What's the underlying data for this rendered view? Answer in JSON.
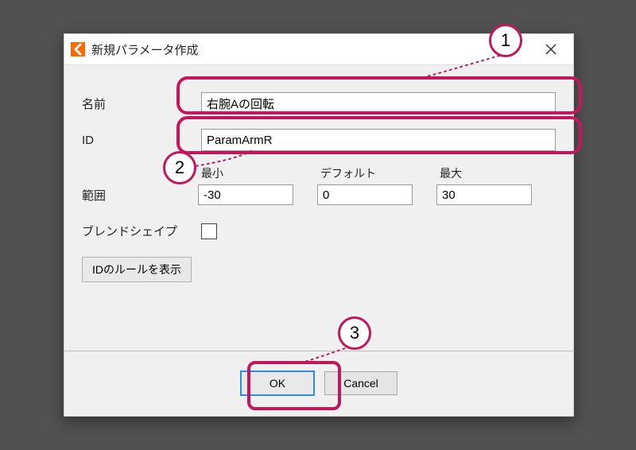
{
  "window": {
    "title": "新規パラメータ作成"
  },
  "labels": {
    "name": "名前",
    "id": "ID",
    "range": "範囲",
    "min": "最小",
    "default": "デフォルト",
    "max": "最大",
    "blendshape": "ブレンドシェイプ",
    "show_id_rule": "IDのルールを表示"
  },
  "fields": {
    "name_value": "右腕Aの回転",
    "id_value": "ParamArmR",
    "min_value": "-30",
    "default_value": "0",
    "max_value": "30"
  },
  "buttons": {
    "ok": "OK",
    "cancel": "Cancel"
  },
  "callouts": {
    "c1": "1",
    "c2": "2",
    "c3": "3"
  },
  "colors": {
    "accent": "#c2185b"
  }
}
